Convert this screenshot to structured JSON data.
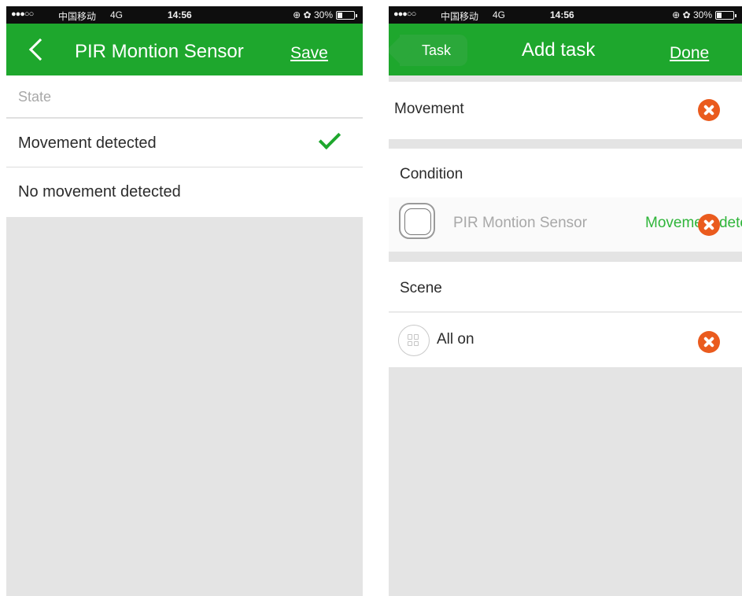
{
  "status_bar": {
    "signal_dots": "●●●○○",
    "carrier": "中国移动",
    "network": "4G",
    "time": "14:56",
    "right_icons": "⊕ ✿",
    "battery_percent": "30%",
    "battery_level": 0.3
  },
  "left_screen": {
    "nav": {
      "title": "PIR Montion Sensor",
      "save_label": "Save"
    },
    "state_header": "State",
    "options": [
      {
        "label": "Movement detected",
        "selected": true
      },
      {
        "label": "No movement detected",
        "selected": false
      }
    ]
  },
  "right_screen": {
    "nav": {
      "back_label": "Task",
      "title": "Add task",
      "done_label": "Done"
    },
    "movement": {
      "label": "Movement"
    },
    "condition": {
      "header": "Condition",
      "device_name": "PIR Montion Sensor",
      "device_state": "Movement detected"
    },
    "scene": {
      "header": "Scene",
      "name": "All on"
    }
  },
  "colors": {
    "accent_green": "#1ea72d",
    "remove_orange": "#ea5b1e",
    "background_gray": "#e4e4e4"
  }
}
